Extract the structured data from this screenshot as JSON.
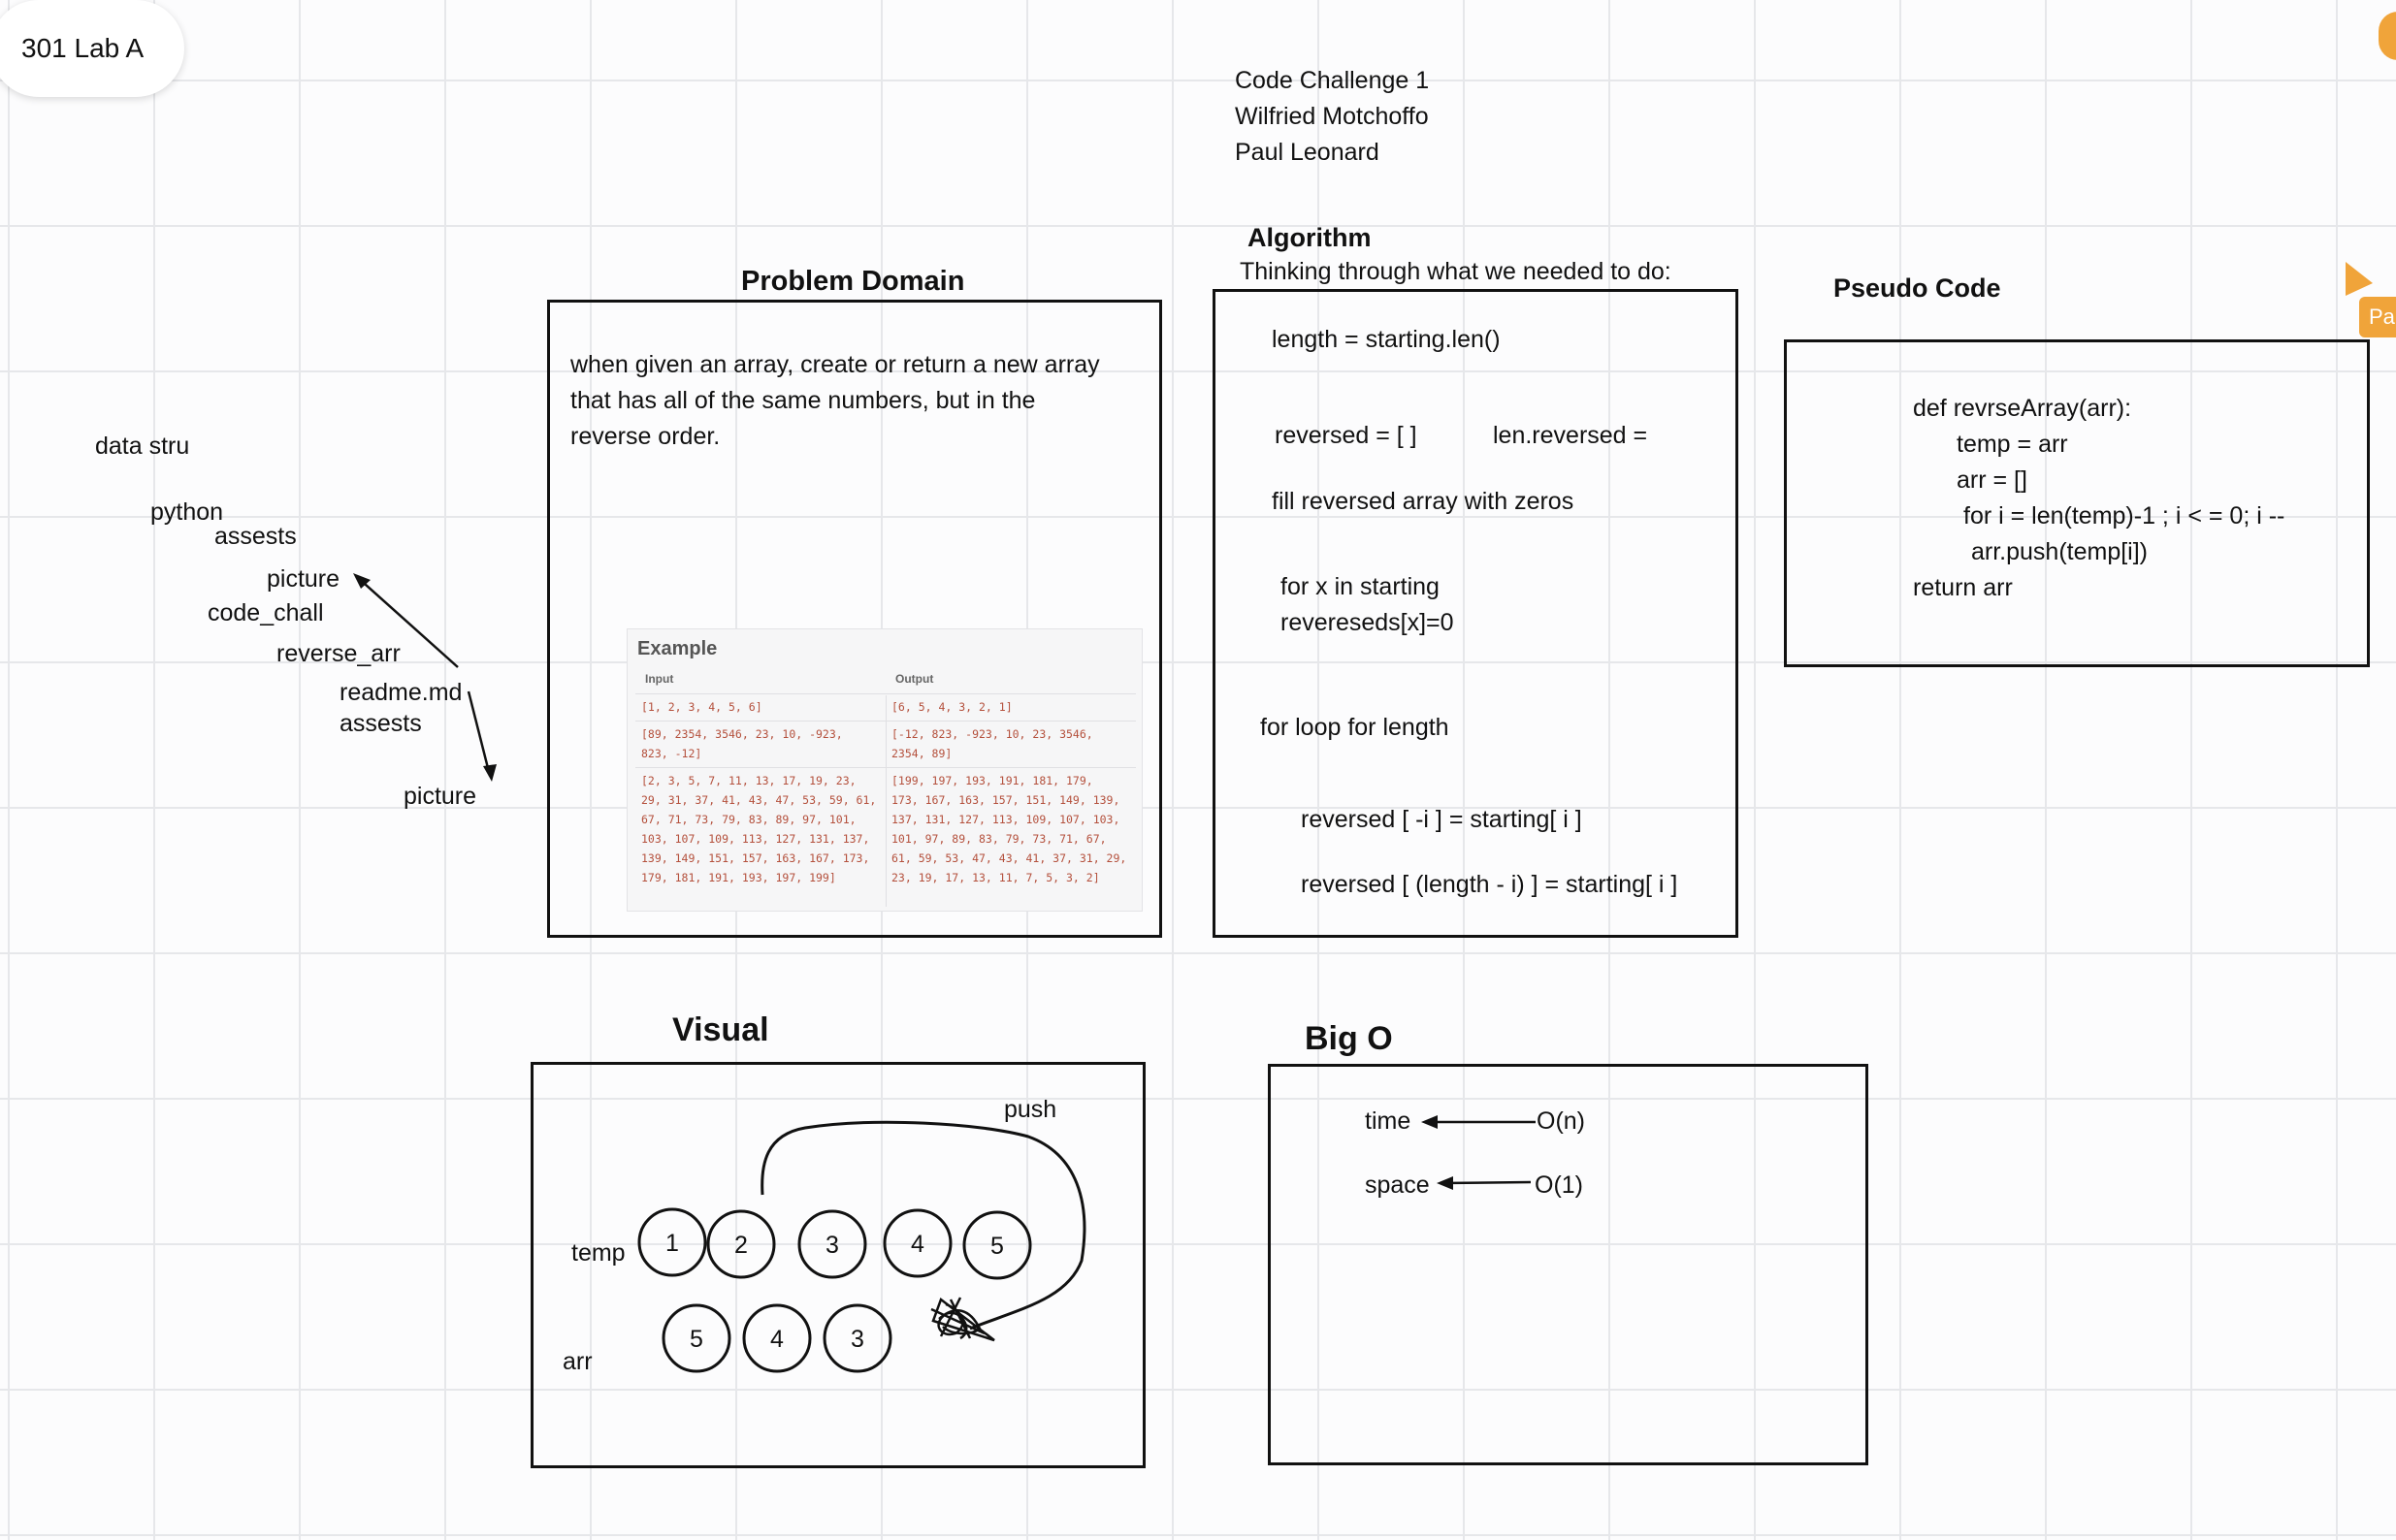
{
  "board": {
    "title": "301 Lab A",
    "cursor_label": "Pa",
    "accent_color": "#f0a43a"
  },
  "header": {
    "line1": "Code Challenge 1",
    "line2": "Wilfried Motchoffo",
    "line3": "Paul Leonard"
  },
  "tree": {
    "items": [
      "data stru",
      "python",
      "assests",
      "picture",
      "code_chall",
      "reverse_arr",
      "readme.md",
      "assests",
      "picture"
    ]
  },
  "problem": {
    "heading": "Problem Domain",
    "lines": [
      "when given an array, create or return a new array",
      "that has all of the same numbers, but in the",
      "reverse order."
    ],
    "example": {
      "title": "Example",
      "input_label": "Input",
      "output_label": "Output",
      "rows": [
        {
          "input": "[1, 2, 3, 4, 5, 6]",
          "output": "[6, 5, 4, 3, 2, 1]"
        },
        {
          "input": "[89, 2354, 3546, 23, 10, -923,\n823, -12]",
          "output": "[-12, 823, -923, 10, 23, 3546,\n2354, 89]"
        },
        {
          "input": "[2, 3, 5, 7, 11, 13, 17, 19, 23,\n29, 31, 37, 41, 43, 47, 53, 59, 61,\n67, 71, 73, 79, 83, 89, 97, 101,\n103, 107, 109, 113, 127, 131, 137,\n139, 149, 151, 157, 163, 167, 173,\n179, 181, 191, 193, 197, 199]",
          "output": "[199, 197, 193, 191, 181, 179,\n173, 167, 163, 157, 151, 149, 139,\n137, 131, 127, 113, 109, 107, 103,\n101, 97, 89, 83, 79, 73, 71, 67,\n61, 59, 53, 47, 43, 41, 37, 31, 29,\n23, 19, 17, 13, 11, 7, 5, 3, 2]"
        }
      ]
    }
  },
  "algorithm": {
    "heading": "Algorithm",
    "subheading": "Thinking through what we needed to do:",
    "lines": [
      "length = starting.len()",
      "reversed = [ ]",
      "len.reversed =",
      "fill reversed array with zeros",
      "for x in starting",
      "revereseds[x]=0",
      "for loop for length",
      "reversed [ -i ] = starting[ i ]",
      "reversed [ (length - i) ] = starting[ i ]"
    ]
  },
  "pseudo": {
    "heading": "Pseudo Code",
    "lines": [
      "def revrseArray(arr):",
      "temp = arr",
      "arr = []",
      "for i = len(temp)-1 ; i < = 0; i --",
      "arr.push(temp[i])",
      "return arr"
    ]
  },
  "visual": {
    "heading": "Visual",
    "push_label": "push",
    "temp_label": "temp",
    "arr_label": "arr",
    "temp_values": [
      "1",
      "2",
      "3",
      "4",
      "5"
    ],
    "arr_values": [
      "5",
      "4",
      "3"
    ]
  },
  "bigo": {
    "heading": "Big O",
    "time_label": "time",
    "time_value": "O(n)",
    "space_label": "space",
    "space_value": "O(1)"
  }
}
